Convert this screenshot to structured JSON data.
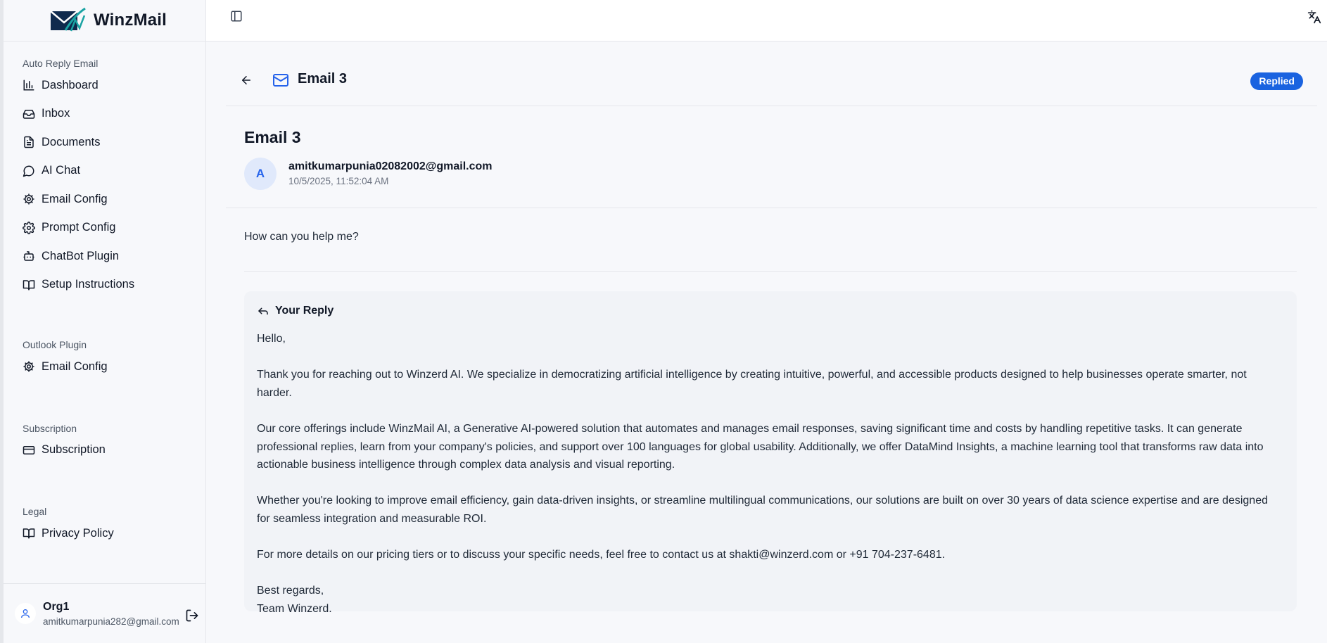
{
  "brand": {
    "name": "WinzMail"
  },
  "sidebar": {
    "sections": [
      {
        "label": "Auto Reply Email",
        "items": [
          {
            "label": "Dashboard",
            "icon": "bar-chart-icon"
          },
          {
            "label": "Inbox",
            "icon": "inbox-icon"
          },
          {
            "label": "Documents",
            "icon": "document-icon"
          },
          {
            "label": "AI Chat",
            "icon": "chat-bubble-icon"
          },
          {
            "label": "Email Config",
            "icon": "gear-icon"
          },
          {
            "label": "Prompt Config",
            "icon": "gear-icon"
          },
          {
            "label": "ChatBot Plugin",
            "icon": "bot-icon"
          },
          {
            "label": "Setup Instructions",
            "icon": "book-icon"
          }
        ]
      },
      {
        "label": "Outlook Plugin",
        "items": [
          {
            "label": "Email Config",
            "icon": "gear-icon"
          }
        ]
      },
      {
        "label": "Subscription",
        "items": [
          {
            "label": "Subscription",
            "icon": "credit-card-icon"
          }
        ]
      },
      {
        "label": "Legal",
        "items": [
          {
            "label": "Privacy Policy",
            "icon": "book-icon"
          }
        ]
      }
    ],
    "user": {
      "org": "Org1",
      "email": "amitkumarpunia282@gmail.com"
    }
  },
  "header": {
    "title": "Email 3",
    "status": "Replied"
  },
  "email": {
    "subject": "Email 3",
    "avatar_letter": "A",
    "from": "amitkumarpunia02082002@gmail.com",
    "date": "10/5/2025, 11:52:04 AM",
    "body": "How can you help me?"
  },
  "reply": {
    "heading": "Your Reply",
    "greeting": "Hello,",
    "p1": "Thank you for reaching out to Winzerd AI. We specialize in democratizing artificial intelligence by creating intuitive, powerful, and accessible products designed to help businesses operate smarter, not harder.",
    "p2": "Our core offerings include WinzMail AI, a Generative AI-powered solution that automates and manages email responses, saving significant time and costs by handling repetitive tasks. It can generate professional replies, learn from your company's policies, and support over 100 languages for global usability. Additionally, we offer DataMind Insights, a machine learning tool that transforms raw data into actionable business intelligence through complex data analysis and visual reporting.",
    "p3": "Whether you're looking to improve email efficiency, gain data-driven insights, or streamline multilingual communications, our solutions are built on over 30 years of data science expertise and are designed for seamless integration and measurable ROI.",
    "p4": "For more details on our pricing tiers or to discuss your specific needs, feel free to contact us at shakti@winzerd.com or +91 704-237-6481.",
    "closing": "Best regards,",
    "signature": "Team Winzerd."
  },
  "colors": {
    "accent": "#1a63e0",
    "sidebar_bg": "#f7f8fb",
    "avatar_bg": "#e0e9fb"
  }
}
